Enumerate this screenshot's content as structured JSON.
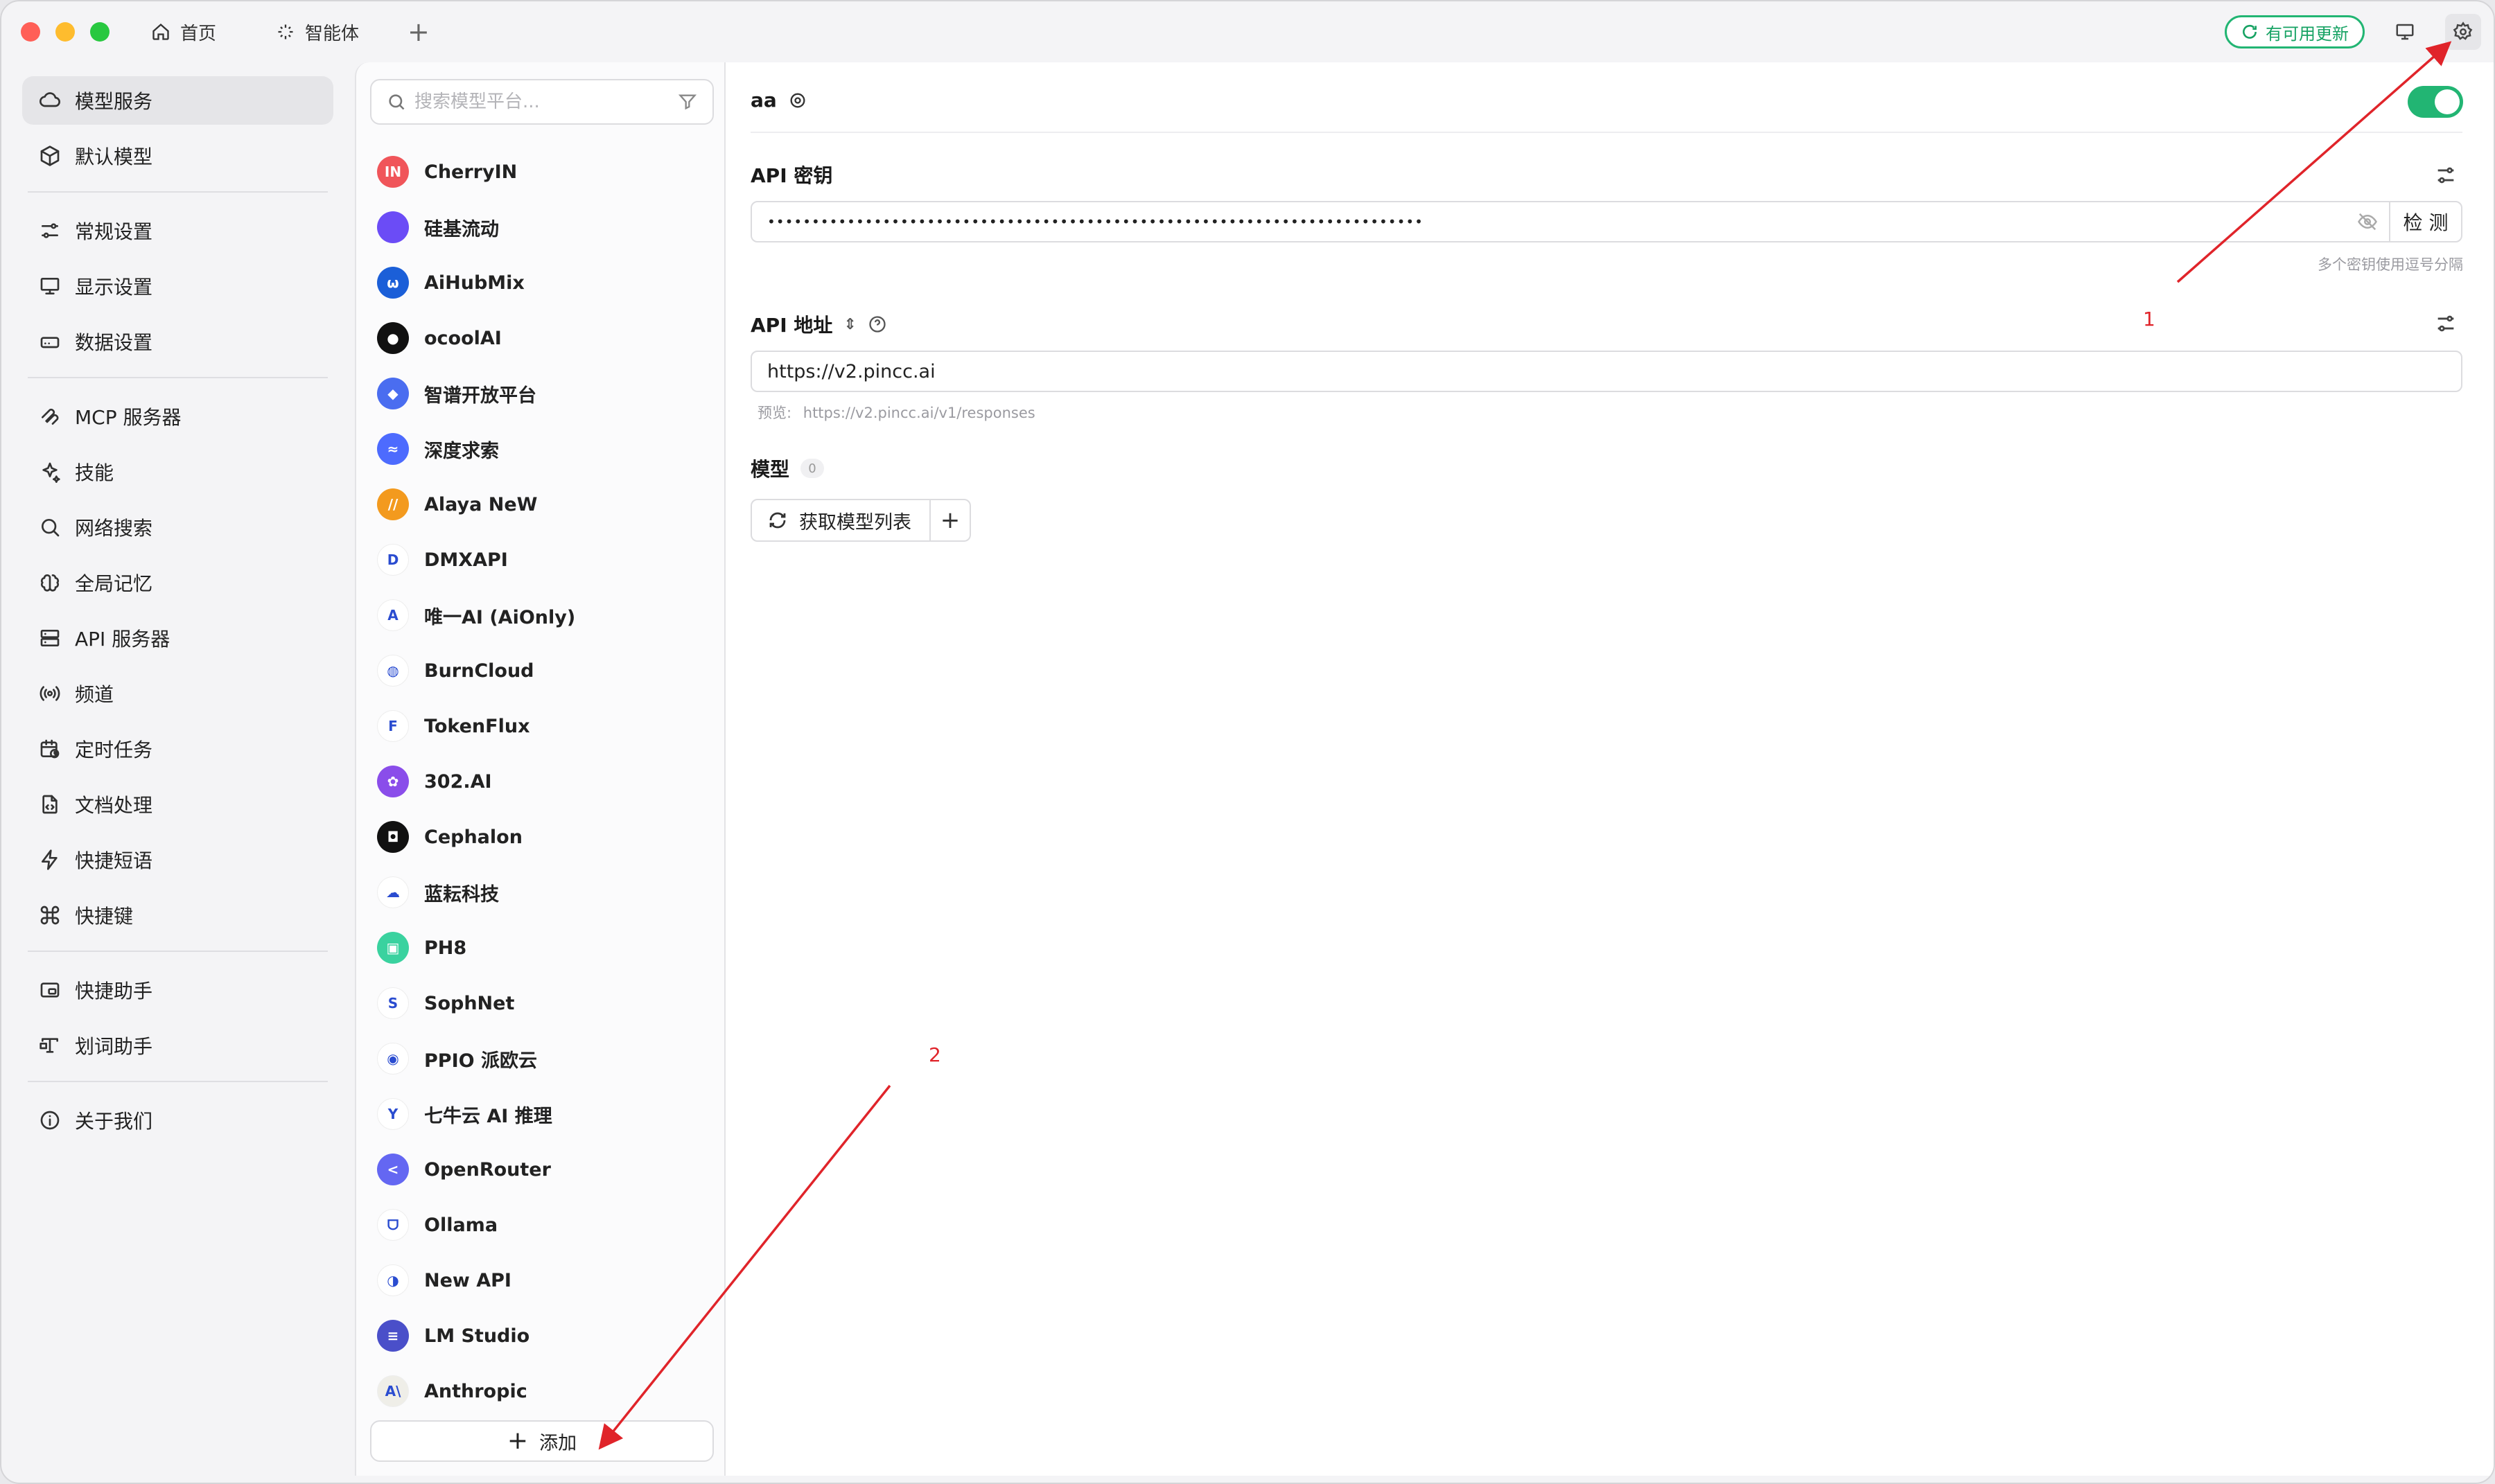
{
  "titlebar": {
    "tabs": [
      {
        "label": "首页",
        "icon": "home-icon"
      },
      {
        "label": "智能体",
        "icon": "sparkle-icon"
      }
    ],
    "update_label": "有可用更新",
    "icons": [
      "refresh-icon",
      "monitor-icon",
      "gear-icon"
    ]
  },
  "sidebar": {
    "groups": [
      [
        {
          "label": "模型服务",
          "icon": "cloud-icon",
          "active": true
        },
        {
          "label": "默认模型",
          "icon": "cube-icon"
        }
      ],
      [
        {
          "label": "常规设置",
          "icon": "sliders-icon"
        },
        {
          "label": "显示设置",
          "icon": "display-icon"
        },
        {
          "label": "数据设置",
          "icon": "drive-icon"
        }
      ],
      [
        {
          "label": "MCP 服务器",
          "icon": "mcp-icon"
        },
        {
          "label": "技能",
          "icon": "sparkles-icon"
        },
        {
          "label": "网络搜索",
          "icon": "search-icon"
        },
        {
          "label": "全局记忆",
          "icon": "brain-icon"
        },
        {
          "label": "API 服务器",
          "icon": "server-icon"
        },
        {
          "label": "频道",
          "icon": "radio-icon"
        },
        {
          "label": "定时任务",
          "icon": "calendar-clock-icon"
        },
        {
          "label": "文档处理",
          "icon": "file-code-icon"
        },
        {
          "label": "快捷短语",
          "icon": "zap-icon"
        },
        {
          "label": "快捷键",
          "icon": "command-icon"
        }
      ],
      [
        {
          "label": "快捷助手",
          "icon": "assistant-icon"
        },
        {
          "label": "划词助手",
          "icon": "text-select-icon"
        }
      ],
      [
        {
          "label": "关于我们",
          "icon": "info-icon"
        }
      ]
    ]
  },
  "provider_panel": {
    "search_placeholder": "搜索模型平台...",
    "providers": [
      {
        "name": "CherryIN",
        "logo_text": "IN",
        "color": "#f0555a"
      },
      {
        "name": "硅基流动",
        "logo_text": "",
        "color": "#6b4cf6"
      },
      {
        "name": "AiHubMix",
        "logo_text": "ω",
        "color": "#1b5fd8"
      },
      {
        "name": "ocoolAI",
        "logo_text": "●",
        "color": "#111111"
      },
      {
        "name": "智谱开放平台",
        "logo_text": "◆",
        "color": "#4a6df0"
      },
      {
        "name": "深度求索",
        "logo_text": "≈",
        "color": "#4d6bfe"
      },
      {
        "name": "Alaya NeW",
        "logo_text": "//",
        "color": "#f39a1e"
      },
      {
        "name": "DMXAPI",
        "logo_text": "D",
        "color": "#ffffff"
      },
      {
        "name": "唯一AI (AiOnly)",
        "logo_text": "A",
        "color": "#ffffff"
      },
      {
        "name": "BurnCloud",
        "logo_text": "◍",
        "color": "#ffffff"
      },
      {
        "name": "TokenFlux",
        "logo_text": "F",
        "color": "#ffffff"
      },
      {
        "name": "302.AI",
        "logo_text": "✿",
        "color": "#8a4dea"
      },
      {
        "name": "Cephalon",
        "logo_text": "◘",
        "color": "#111111"
      },
      {
        "name": "蓝耘科技",
        "logo_text": "☁",
        "color": "#ffffff"
      },
      {
        "name": "PH8",
        "logo_text": "▣",
        "color": "#3ad29f"
      },
      {
        "name": "SophNet",
        "logo_text": "S",
        "color": "#ffffff"
      },
      {
        "name": "PPIO 派欧云",
        "logo_text": "◉",
        "color": "#ffffff"
      },
      {
        "name": "七牛云 AI 推理",
        "logo_text": "Y",
        "color": "#ffffff"
      },
      {
        "name": "OpenRouter",
        "logo_text": "<",
        "color": "#6467f2"
      },
      {
        "name": "Ollama",
        "logo_text": "ᗜ",
        "color": "#ffffff"
      },
      {
        "name": "New API",
        "logo_text": "◑",
        "color": "#ffffff"
      },
      {
        "name": "LM Studio",
        "logo_text": "≡",
        "color": "#4a4fc9"
      },
      {
        "name": "Anthropic",
        "logo_text": "A\\",
        "color": "#efeee8"
      }
    ],
    "add_label": "添加"
  },
  "main": {
    "provider_title": "aa",
    "enabled": true,
    "api_key": {
      "label": "API 密钥",
      "value": "••••••••••••••••••••••••••••••••••••••••••••••••••••••••••••••••••••••••••",
      "check_label": "检 测",
      "hint": "多个密钥使用逗号分隔"
    },
    "api_url": {
      "label": "API 地址",
      "value": "https://v2.pincc.ai",
      "preview_label": "预览:",
      "preview_value": "https://v2.pincc.ai/v1/responses"
    },
    "models": {
      "label": "模型",
      "count": "0",
      "fetch_label": "获取模型列表",
      "add_symbol": "+"
    }
  },
  "annotations": {
    "labels": [
      "1",
      "2"
    ],
    "color": "#e0242a"
  }
}
